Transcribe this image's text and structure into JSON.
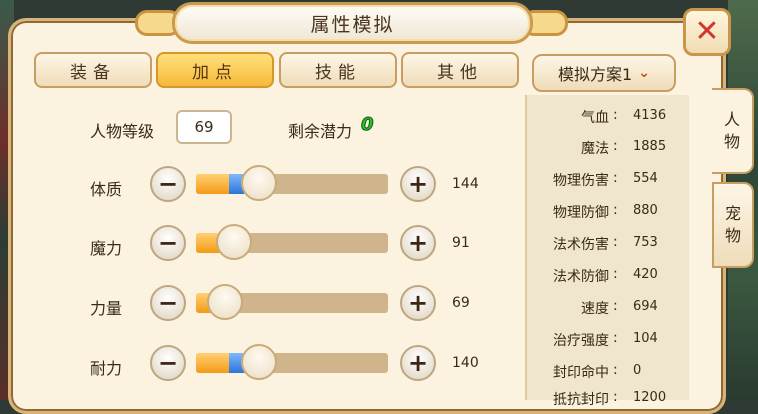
{
  "window": {
    "title": "属性模拟"
  },
  "tabs": [
    {
      "label": "装备",
      "active": false
    },
    {
      "label": "加点",
      "active": true
    },
    {
      "label": "技能",
      "active": false
    },
    {
      "label": "其他",
      "active": false
    }
  ],
  "character": {
    "level_label": "人物等级",
    "level_value": "69",
    "potential_label": "剩余潜力",
    "potential_value": "0"
  },
  "attributes": [
    {
      "label": "体质",
      "value": "144",
      "orange_fill": 0.17,
      "blue_fill": 0.08,
      "thumb": 0.33
    },
    {
      "label": "魔力",
      "value": "91",
      "orange_fill": 0.2,
      "blue_fill": 0.0,
      "thumb": 0.2
    },
    {
      "label": "力量",
      "value": "69",
      "orange_fill": 0.15,
      "blue_fill": 0.0,
      "thumb": 0.15
    },
    {
      "label": "耐力",
      "value": "140",
      "orange_fill": 0.17,
      "blue_fill": 0.08,
      "thumb": 0.33
    }
  ],
  "scheme": {
    "label": "模拟方案1"
  },
  "stats": [
    {
      "name": "气血",
      "value": "4136"
    },
    {
      "name": "魔法",
      "value": "1885"
    },
    {
      "name": "物理伤害",
      "value": "554"
    },
    {
      "name": "物理防御",
      "value": "880"
    },
    {
      "name": "法术伤害",
      "value": "753"
    },
    {
      "name": "法术防御",
      "value": "420"
    },
    {
      "name": "速度",
      "value": "694"
    },
    {
      "name": "治疗强度",
      "value": "104"
    },
    {
      "name": "封印命中",
      "value": "0"
    },
    {
      "name": "抵抗封印",
      "value": "1200"
    }
  ],
  "side_tabs": [
    {
      "label": "人物",
      "active": true
    },
    {
      "label": "宠物",
      "active": false
    }
  ],
  "icons": {
    "close": "close-icon",
    "minus": "minus-icon",
    "plus": "plus-icon",
    "dropdown": "chevron-down-icon"
  },
  "colors": {
    "accent": "#f6b93b",
    "potential": "#2fbf2a",
    "close": "#d3352b"
  }
}
